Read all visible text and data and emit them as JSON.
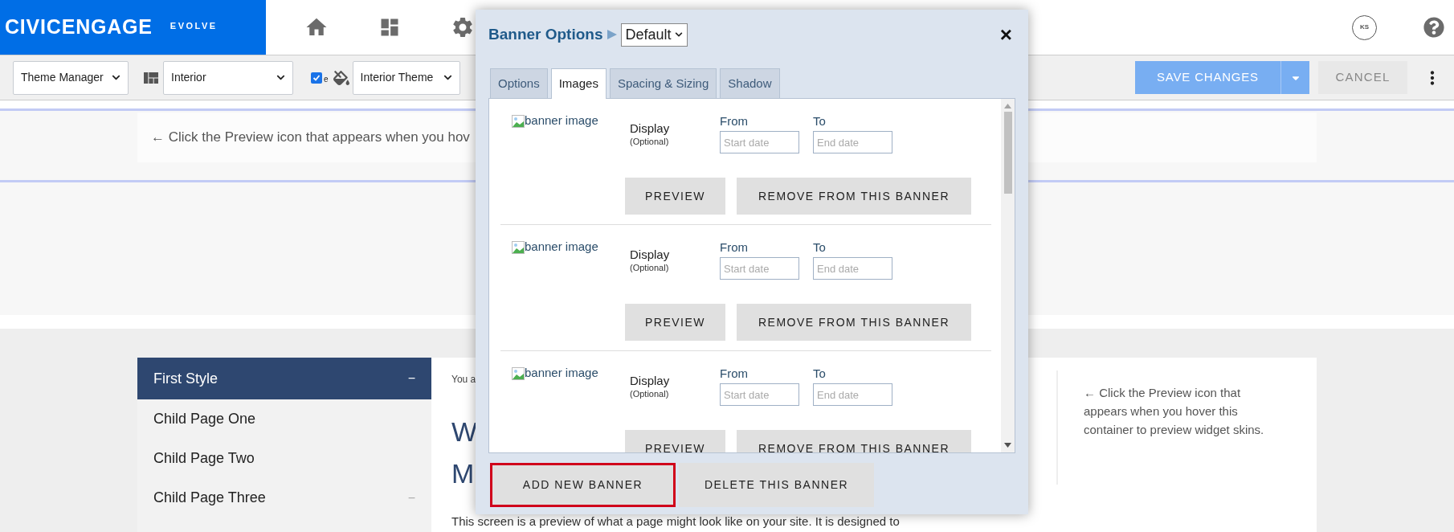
{
  "header": {
    "logo": "CIVICENGAGE",
    "logo_sub": "EVOLVE",
    "avatar": "KS"
  },
  "toolbar": {
    "selects": [
      {
        "value": "Theme Manager"
      },
      {
        "value": "Interior"
      },
      {
        "value": "Interior Theme"
      }
    ],
    "checkbox": {
      "checked": true,
      "label": "e"
    },
    "save": "SAVE CHANGES",
    "cancel": "CANCEL"
  },
  "preview_hint": "← Click the Preview icon that appears when you hov",
  "sidebar": {
    "items": [
      {
        "label": "First Style",
        "selected": true,
        "toggle": "−"
      },
      {
        "label": "Child Page One",
        "selected": false
      },
      {
        "label": "Child Page Two",
        "selected": false
      },
      {
        "label": "Child Page Three",
        "selected": false,
        "toggle": "−"
      }
    ]
  },
  "content": {
    "breadcrumb": "You a",
    "heading_lines": [
      "W",
      "M"
    ],
    "paragraph": "This screen is a preview of what a page might look like on your site. It is designed to"
  },
  "aside": "← Click the Preview icon that appears when you hover this container to preview widget skins.",
  "dialog": {
    "title": "Banner Options",
    "preset": "Default",
    "close": "×",
    "tabs": [
      {
        "label": "Options",
        "selected": false
      },
      {
        "label": "Images",
        "selected": true
      },
      {
        "label": "Spacing & Sizing",
        "selected": false
      },
      {
        "label": "Shadow",
        "selected": false
      }
    ],
    "images": [
      {
        "alt": "banner image",
        "display": "Display",
        "optional": "(Optional)",
        "from": "From",
        "to": "To",
        "start_placeholder": "Start date",
        "end_placeholder": "End date",
        "buttons": [
          "PREVIEW",
          "REMOVE FROM THIS BANNER"
        ]
      },
      {
        "alt": "banner image",
        "display": "Display",
        "optional": "(Optional)",
        "from": "From",
        "to": "To",
        "start_placeholder": "Start date",
        "end_placeholder": "End date",
        "buttons": [
          "PREVIEW",
          "REMOVE FROM THIS BANNER"
        ]
      },
      {
        "alt": "banner image",
        "display": "Display",
        "optional": "(Optional)",
        "from": "From",
        "to": "To",
        "start_placeholder": "Start date",
        "end_placeholder": "End date",
        "buttons": [
          "PREVIEW",
          "REMOVE FROM THIS BANNER"
        ]
      }
    ],
    "footer_buttons": [
      {
        "label": "ADD NEW BANNER",
        "focused": true
      },
      {
        "label": "DELETE THIS BANNER",
        "focused": false
      }
    ]
  }
}
